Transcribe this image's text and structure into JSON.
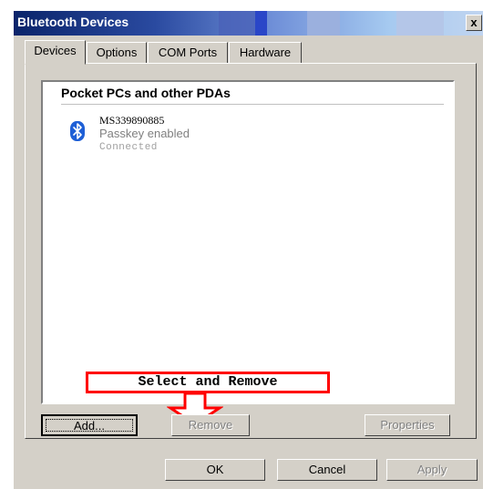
{
  "window": {
    "title": "Bluetooth Devices",
    "close_label": "x"
  },
  "tabs": [
    {
      "label": "Devices",
      "active": true
    },
    {
      "label": "Options",
      "active": false
    },
    {
      "label": "COM Ports",
      "active": false
    },
    {
      "label": "Hardware",
      "active": false
    }
  ],
  "device_list": {
    "group_header": "Pocket PCs and other PDAs",
    "items": [
      {
        "name": "MS339890885",
        "passkey": "Passkey enabled",
        "status": "Connected",
        "icon": "bluetooth-icon"
      }
    ]
  },
  "annotation": {
    "callout_text": "Select and Remove",
    "arrow": "down-arrow-icon"
  },
  "panel_buttons": {
    "add": "Add...",
    "remove": "Remove",
    "properties": "Properties"
  },
  "dialog_buttons": {
    "ok": "OK",
    "cancel": "Cancel",
    "apply": "Apply"
  },
  "colors": {
    "title_gradient_start": "#0a246a",
    "bluetooth_blue": "#1e5fd6",
    "callout_red": "#ff0000",
    "dialog_face": "#d4d0c8"
  }
}
